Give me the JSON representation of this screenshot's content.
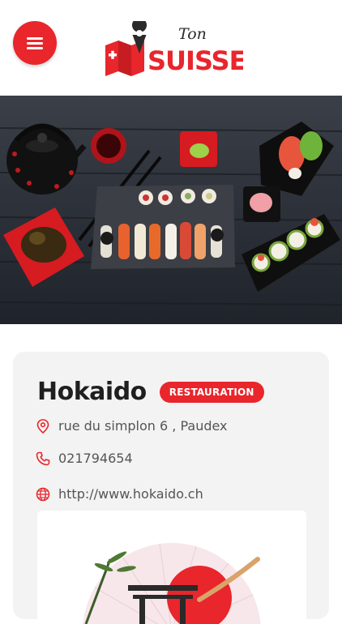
{
  "header": {
    "menu_icon": "hamburger-menu-icon",
    "logo": {
      "script_text": "Ton",
      "main_text": "SUISSE",
      "colors": {
        "red": "#e8262c",
        "dark": "#2b2b2b"
      }
    }
  },
  "hero": {
    "image": "sushi-platter-photo"
  },
  "listing": {
    "name": "Hokaido",
    "category": "RESTAURATION",
    "address": "rue du simplon 6 , Paudex",
    "phone": "021794654",
    "website": "http://www.hokaido.ch"
  },
  "theme": {
    "accent": "#e8262c",
    "card_bg": "#f3f3f3",
    "text": "#1f1f1f",
    "muted": "#555555"
  }
}
